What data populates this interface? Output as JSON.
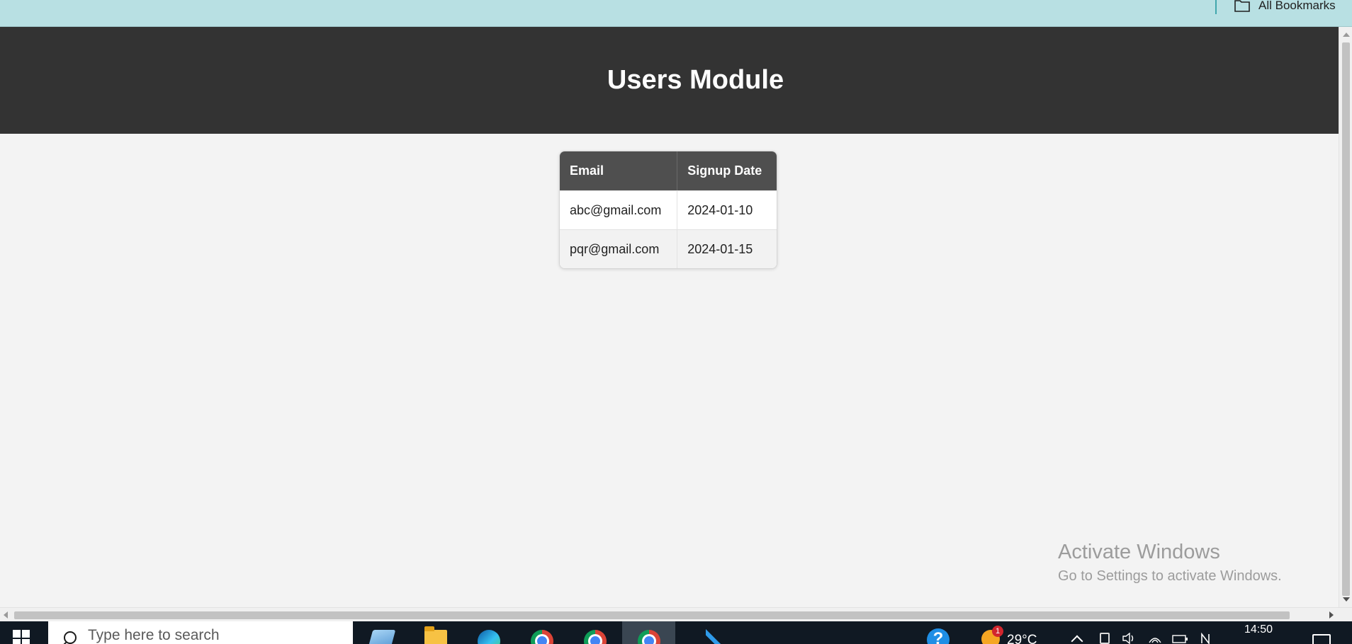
{
  "browser": {
    "bookmarks_bar": {
      "all_bookmarks_label": "All Bookmarks"
    }
  },
  "page": {
    "title": "Users Module",
    "table": {
      "columns": [
        "Email",
        "Signup Date"
      ],
      "rows": [
        {
          "email": "abc@gmail.com",
          "signup_date": "2024-01-10"
        },
        {
          "email": "pqr@gmail.com",
          "signup_date": "2024-01-15"
        }
      ]
    },
    "watermark": {
      "title": "Activate Windows",
      "subtitle": "Go to Settings to activate Windows."
    }
  },
  "taskbar": {
    "search_placeholder": "Type here to search",
    "apps": [
      "notepad-icon",
      "file-explorer-icon",
      "edge-icon",
      "chrome-icon",
      "chrome-icon",
      "chrome-icon",
      "vscode-icon"
    ],
    "weather": {
      "temperature": "29°C",
      "alert_count": "1"
    },
    "clock": "14:50"
  },
  "colors": {
    "header_background": "#333333",
    "table_header_background": "#4f4f4f",
    "bookmarks_bar_background": "#b8e0e3",
    "taskbar_background": "#101923"
  }
}
